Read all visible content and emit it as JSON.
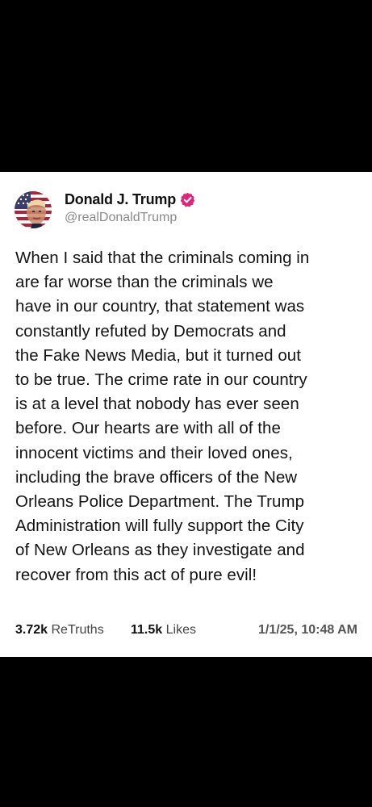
{
  "post": {
    "author": {
      "display_name": "Donald J. Trump",
      "handle": "@realDonaldTrump",
      "verified_color": "#e0247a",
      "avatar_icon": "avatar-american-flag-portrait"
    },
    "lines": [
      "When I said that the criminals coming in",
      "are far worse than the criminals we",
      "have in our country, that statement was",
      "constantly refuted by Democrats and",
      "the Fake News Media, but it turned out",
      "to be true. The crime rate in our country",
      "is at a level that nobody has ever seen",
      "before. Our hearts are with all of the",
      "innocent victims and their loved ones,",
      "including the brave officers of the New",
      "Orleans Police Department. The Trump",
      "Administration will fully support the City",
      "of New Orleans as they investigate and",
      "recover from this act of pure evil!"
    ],
    "stats": {
      "retruths_count": "3.72k",
      "retruths_label": "ReTruths",
      "likes_count": "11.5k",
      "likes_label": "Likes",
      "timestamp": "1/1/25, 10:48 AM"
    }
  }
}
